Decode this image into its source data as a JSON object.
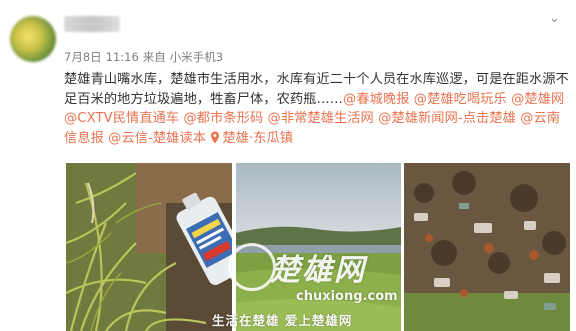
{
  "post": {
    "date": "7月8日",
    "time": "11:16",
    "source_prefix": "来自",
    "source_device": "小米手机3",
    "text": "楚雄青山嘴水库，楚雄市生活用水，水库有近二十个人员在水库巡逻，可是在距水源不足百米的地方垃圾遍地，牲畜尸体，农药瓶……",
    "mentions": [
      "@春城晚报",
      "@楚雄吃喝玩乐",
      "@楚雄网",
      "@CXTV民情直通车",
      "@都市条形码",
      "@非常楚雄生活网",
      "@楚雄新闻网-点击楚雄",
      "@云南信息报",
      "@云信-楚雄读本"
    ],
    "location": "楚雄·东瓜镇"
  },
  "icons": {
    "menu": "chevron-down-icon",
    "location": "location-pin-icon"
  },
  "watermark": {
    "name": "楚雄网",
    "domain": "chuxiong.com",
    "slogan": "生活在楚雄  爱上楚雄网"
  },
  "colors": {
    "link": "#eb7350",
    "meta_text": "#808080",
    "body_text": "#333333"
  }
}
